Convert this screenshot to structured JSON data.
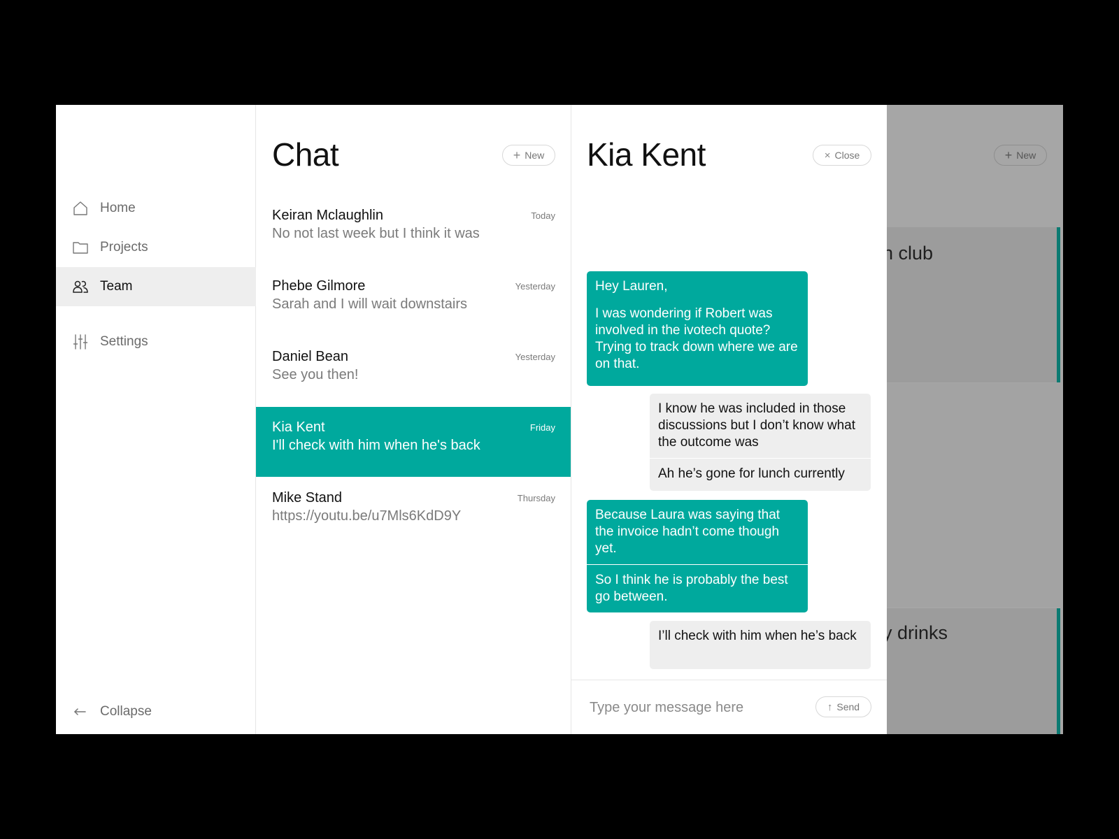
{
  "sidebar": {
    "items": [
      {
        "label": "Home",
        "icon": "home-icon"
      },
      {
        "label": "Projects",
        "icon": "folder-icon"
      },
      {
        "label": "Team",
        "icon": "team-icon",
        "active": true
      },
      {
        "label": "Settings",
        "icon": "sliders-icon"
      }
    ],
    "collapse_label": "Collapse",
    "collapse_icon": "arrow-left-icon"
  },
  "chat_list": {
    "title": "Chat",
    "new_label": "New",
    "conversations": [
      {
        "name": "Keiran Mclaughlin",
        "preview": "No not last week but I think it was",
        "time": "Today"
      },
      {
        "name": "Phebe Gilmore",
        "preview": "Sarah and I will wait downstairs",
        "time": "Yesterday"
      },
      {
        "name": "Daniel Bean",
        "preview": "See you then!",
        "time": "Yesterday"
      },
      {
        "name": "Kia Kent",
        "preview": "I'll check with him when he's back",
        "time": "Friday",
        "active": true
      },
      {
        "name": "Mike Stand",
        "preview": "https://youtu.be/u7Mls6KdD9Y",
        "time": "Thursday"
      }
    ]
  },
  "conversation": {
    "title": "Kia Kent",
    "close_label": "Close",
    "messages": [
      {
        "from": "me",
        "text": "Hey Lauren,"
      },
      {
        "from": "me",
        "text": "I was wondering if Robert was involved in the ivotech quote? Trying to track down where we are on that."
      },
      {
        "from": "them",
        "text": "I know he was included in those discussions but I don’t know what the outcome was"
      },
      {
        "from": "them",
        "text": "Ah he’s gone for lunch currently"
      },
      {
        "from": "me",
        "text": "Because Laura was saying that the invoice hadn’t come though yet."
      },
      {
        "from": "me",
        "text": "So I think he is probably the best go between."
      },
      {
        "from": "them",
        "text": "I’ll check with him when he’s back"
      }
    ],
    "composer": {
      "placeholder": "Type your message here",
      "send_label": "Send"
    }
  },
  "background_panel": {
    "new_label": "New",
    "card_titles": [
      "n club",
      "y drinks"
    ]
  },
  "colors": {
    "accent": "#00a99d",
    "received_bubble": "#eeeeee",
    "active_nav": "#eeeeee",
    "dimmed_overlay": "#a6a6a6"
  }
}
